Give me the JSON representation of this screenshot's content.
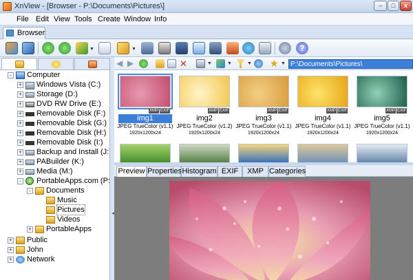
{
  "window": {
    "title": "XnView - [Browser - P:\\Documents\\Pictures\\]",
    "buttons": {
      "minimize": "–",
      "maximize": "□",
      "close": "x"
    }
  },
  "menu": [
    "File",
    "Edit",
    "View",
    "Tools",
    "Create",
    "Window",
    "Info"
  ],
  "tabs": [
    "Browser"
  ],
  "path": {
    "value": "P:\\Documents\\Pictures\\"
  },
  "tree": [
    {
      "label": "Computer",
      "icon": "computer-icon",
      "expander": "-"
    },
    {
      "label": "Windows Vista (C:)",
      "icon": "drive-icon",
      "expander": "+"
    },
    {
      "label": "Storage (D:)",
      "icon": "drive-icon",
      "expander": "+"
    },
    {
      "label": "DVD RW Drive (E:)",
      "icon": "dvd-icon",
      "expander": "+"
    },
    {
      "label": "Removable Disk (F:)",
      "icon": "removable-disk-icon",
      "expander": "+"
    },
    {
      "label": "Removable Disk (G:)",
      "icon": "removable-disk-icon",
      "expander": "+"
    },
    {
      "label": "Removable Disk (H:)",
      "icon": "removable-disk-icon",
      "expander": "+"
    },
    {
      "label": "Removable Disk (I:)",
      "icon": "removable-disk-icon",
      "expander": "+"
    },
    {
      "label": "Backup and Install (J:)",
      "icon": "drive-icon",
      "expander": "+"
    },
    {
      "label": "PABuilder (K:)",
      "icon": "drive-icon",
      "expander": "+"
    },
    {
      "label": "Media (M:)",
      "icon": "drive-icon",
      "expander": "+"
    },
    {
      "label": "PortableApps.com (P:)",
      "icon": "portableapps-drive-icon",
      "expander": "-"
    },
    {
      "label": "Documents",
      "icon": "folder-icon",
      "expander": "-"
    },
    {
      "label": "Music",
      "icon": "folder-icon",
      "expander": ""
    },
    {
      "label": "Pictures",
      "icon": "folder-icon",
      "expander": ""
    },
    {
      "label": "Videos",
      "icon": "folder-icon",
      "expander": ""
    },
    {
      "label": "PortableApps",
      "icon": "folder-icon",
      "expander": "+"
    },
    {
      "label": "Public",
      "icon": "folder-icon",
      "expander": "+"
    },
    {
      "label": "John",
      "icon": "folder-icon",
      "expander": "+"
    },
    {
      "label": "Network",
      "icon": "network-icon",
      "expander": "+"
    }
  ],
  "thumbnails": [
    {
      "name": "img1",
      "format": "JPEG TrueColor (v1.1)",
      "size": "1920x1200x24",
      "tags": [
        "XMP",
        "EXIF"
      ],
      "colors": [
        "#c44b6e",
        "#e79ab0"
      ]
    },
    {
      "name": "img2",
      "format": "JPEG TrueColor (v1.2)",
      "size": "1920x1200x24",
      "tags": [
        "XMP",
        "EXIF"
      ],
      "colors": [
        "#f3c64c",
        "#fff4c9"
      ]
    },
    {
      "name": "img3",
      "format": "JPEG TrueColor (v1.1)",
      "size": "1920x1200x24",
      "tags": [
        "XMP",
        "EXIF"
      ],
      "colors": [
        "#d99a3c",
        "#f2cf84"
      ]
    },
    {
      "name": "img4",
      "format": "JPEG TrueColor (v1.1)",
      "size": "1920x1200x24",
      "tags": [
        "XMP",
        "EXIF"
      ],
      "colors": [
        "#e7a313",
        "#fde46a"
      ]
    },
    {
      "name": "img5",
      "format": "JPEG TrueColor (v1.1)",
      "size": "1920x1200x24",
      "tags": [
        "XMP",
        "EXIF"
      ],
      "colors": [
        "#1d5b4a",
        "#8fd0b5"
      ]
    }
  ],
  "thumbnails_row2_colors": [
    [
      "#3f8a2c",
      "#a5d266"
    ],
    [
      "#4d7a3d",
      "#cfd9c3"
    ],
    [
      "#2d6bbf",
      "#f2d57d"
    ],
    [
      "#6b8fb8",
      "#dcc89a"
    ],
    [
      "#5b7fa6",
      "#e4ebf3"
    ]
  ],
  "preview_tabs": [
    "Preview",
    "Properties",
    "Histogram",
    "EXIF",
    "XMP",
    "Categories"
  ],
  "colors": {
    "accent": "#3c7fd8",
    "preview_bg": "#7d7d7d"
  }
}
